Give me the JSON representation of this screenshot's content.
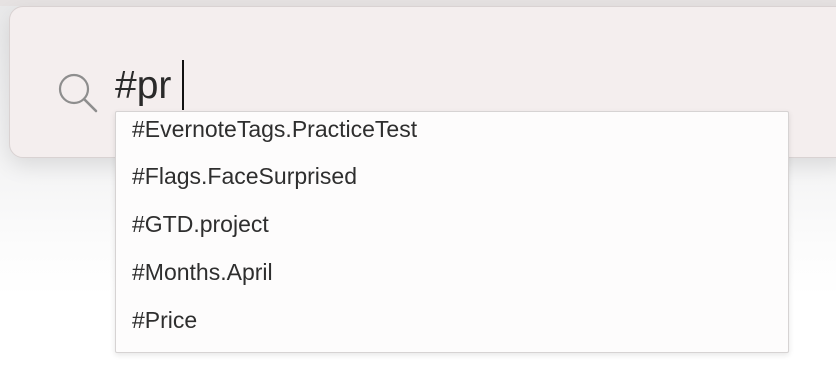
{
  "search": {
    "query": "#pr"
  },
  "suggestions": [
    {
      "label": "#EvernoteTags.PracticeTest"
    },
    {
      "label": "#Flags.FaceSurprised"
    },
    {
      "label": "#GTD.project"
    },
    {
      "label": "#Months.April"
    },
    {
      "label": "#Price"
    }
  ],
  "background_hint": ":a",
  "icons": {
    "search": "search-icon"
  },
  "colors": {
    "window_background": "#f4eeee",
    "dropdown_background": "#fdfcfc",
    "text": "#2e2e2e",
    "icon": "#8e8e8e"
  }
}
